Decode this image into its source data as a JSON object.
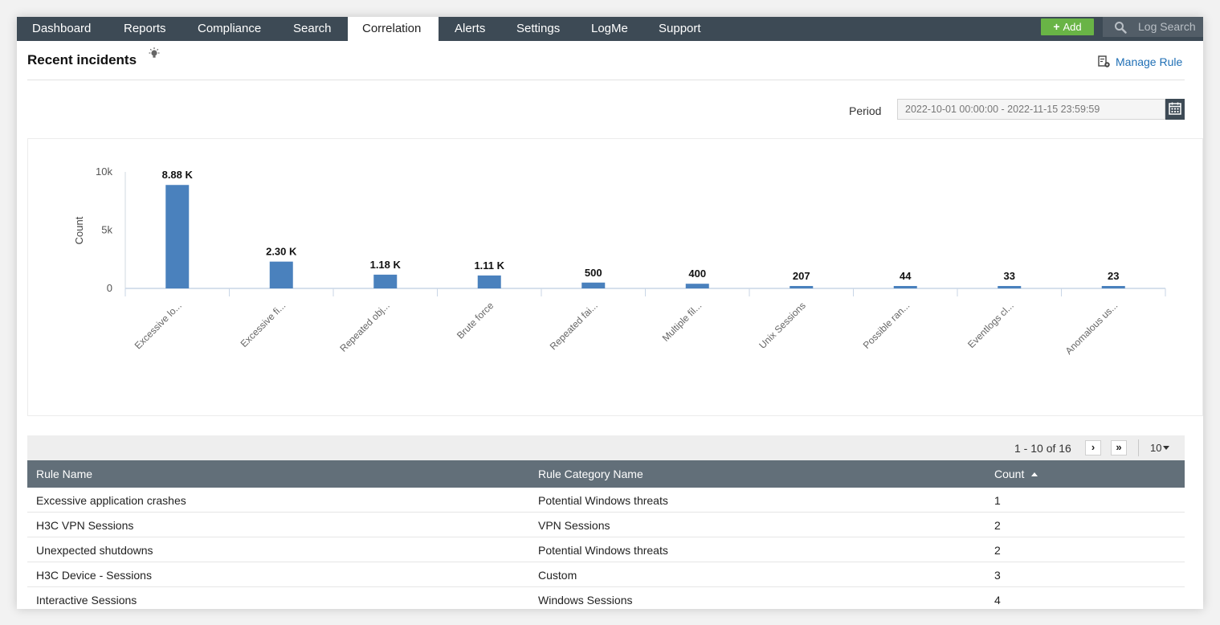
{
  "nav": {
    "tabs": [
      {
        "label": "Dashboard"
      },
      {
        "label": "Reports"
      },
      {
        "label": "Compliance"
      },
      {
        "label": "Search"
      },
      {
        "label": "Correlation",
        "active": true
      },
      {
        "label": "Alerts"
      },
      {
        "label": "Settings"
      },
      {
        "label": "LogMe"
      },
      {
        "label": "Support"
      }
    ],
    "add_label": "Add",
    "log_search_placeholder": "Log Search"
  },
  "header": {
    "title": "Recent incidents",
    "manage_rule_label": "Manage Rule"
  },
  "period": {
    "label": "Period",
    "value": "2022-10-01 00:00:00 - 2022-11-15 23:59:59"
  },
  "colors": {
    "nav_bg": "#3d4a55",
    "bar": "#4a81bd",
    "add_button": "#69b446",
    "link": "#1f6fb5",
    "table_header": "#626f79"
  },
  "chart_data": {
    "type": "bar",
    "ylabel": "Count",
    "ylim": [
      0,
      10000
    ],
    "yticks": [
      {
        "value": 0,
        "label": "0"
      },
      {
        "value": 5000,
        "label": "5k"
      },
      {
        "value": 10000,
        "label": "10k"
      }
    ],
    "categories": [
      "Excessive lo...",
      "Excessive fi...",
      "Repeated obj...",
      "Brute force",
      "Repeated fai...",
      "Multiple fil...",
      "Unix Sessions",
      "Possible ran...",
      "Eventlogs cl...",
      "Anomalous us..."
    ],
    "values": [
      8880,
      2300,
      1180,
      1110,
      500,
      400,
      207,
      44,
      33,
      23
    ],
    "data_labels": [
      "8.88 K",
      "2.30 K",
      "1.18 K",
      "1.11 K",
      "500",
      "400",
      "207",
      "44",
      "33",
      "23"
    ]
  },
  "pager": {
    "range_text": "1 - 10 of 16",
    "next_label": "›",
    "last_label": "»",
    "page_size": "10"
  },
  "table": {
    "columns": [
      "Rule Name",
      "Rule Category Name",
      "Count"
    ],
    "rows": [
      [
        "Excessive application crashes",
        "Potential Windows threats",
        "1"
      ],
      [
        "H3C VPN Sessions",
        "VPN Sessions",
        "2"
      ],
      [
        "Unexpected shutdowns",
        "Potential Windows threats",
        "2"
      ],
      [
        "H3C Device - Sessions",
        "Custom",
        "3"
      ],
      [
        "Interactive Sessions",
        "Windows Sessions",
        "4"
      ]
    ]
  }
}
